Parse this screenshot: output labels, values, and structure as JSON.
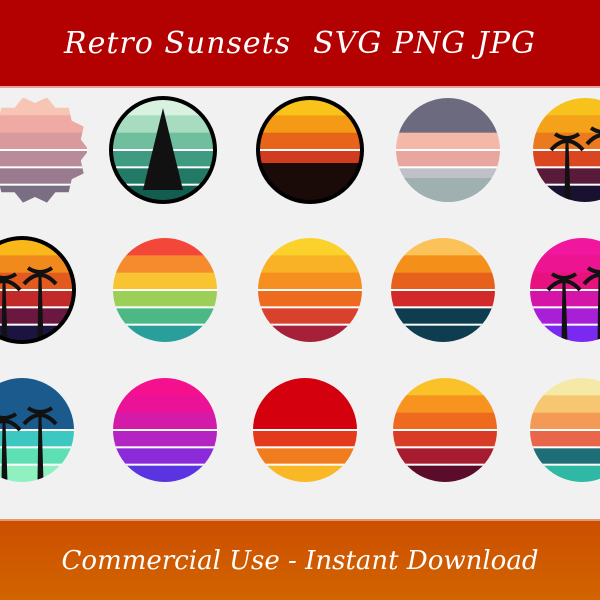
{
  "header": {
    "title": "Retro Sunsets",
    "formats": "SVG PNG JPG",
    "background": "#b30000"
  },
  "footer": {
    "text": "Commercial Use  -  Instant Download",
    "background": "#cc5200"
  },
  "sunsets": [
    {
      "colors": [
        "#f7c5b4",
        "#eeaaa3",
        "#d99a9e",
        "#b98a98",
        "#9a7a8e",
        "#7a6e82"
      ],
      "shape": "scalloped"
    },
    {
      "colors": [
        "#d9f2e0",
        "#a8dcc0",
        "#6fbf9e",
        "#3e9a80",
        "#227a66",
        "#135c50"
      ],
      "border": "#000",
      "silhouette": "pine-tree"
    },
    {
      "colors": [
        "#f9c31c",
        "#f59a15",
        "#e8641b",
        "#d13b1f",
        "#a61a1a",
        "#6e0e10"
      ],
      "border": "#000",
      "silhouette": "forest"
    },
    {
      "colors": [
        "#6c6a7e",
        "#6c6a7e",
        "#f3b8a8",
        "#e9a6a0",
        "#c0c0c8",
        "#9c9aa6"
      ],
      "silhouette": "treeline"
    },
    {
      "colors": [
        "#f7c21b",
        "#f4a21a",
        "#ea7a1d",
        "#d9461f",
        "#5a1a3a",
        "#1a1030"
      ],
      "silhouette": "palm-trees"
    },
    {
      "colors": [
        "#f9b71a",
        "#f08a1c",
        "#e35a1f",
        "#c22a2a",
        "#6a1840",
        "#1c1440"
      ],
      "border": "#000",
      "silhouette": "palm-trees"
    },
    {
      "colors": [
        "#f3473a",
        "#f68b2e",
        "#f8c431",
        "#9ccf58",
        "#4bb885",
        "#2a9e9a"
      ]
    },
    {
      "colors": [
        "#fbd22c",
        "#f9b125",
        "#f58f1f",
        "#ee6a1f",
        "#d8412b",
        "#a6203a"
      ]
    },
    {
      "colors": [
        "#fbc25a",
        "#f49019",
        "#e6611c",
        "#d22a2a",
        "#0d3d4f",
        "#0d3d4f"
      ]
    },
    {
      "colors": [
        "#f0179e",
        "#ec1490",
        "#e8127f",
        "#d514a8",
        "#a720d8",
        "#7a2af0"
      ],
      "silhouette": "palm-leaf"
    },
    {
      "colors": [
        "#1a5a8c",
        "#1a5a8c",
        "#1a5a8c",
        "#3cc8c0",
        "#5fe0b4",
        "#8ff0c0"
      ],
      "silhouette": "palm-trees"
    },
    {
      "colors": [
        "#f5118e",
        "#ea1296",
        "#d41aa8",
        "#b324c2",
        "#8a2ad8",
        "#5a34e0"
      ]
    },
    {
      "colors": [
        "#d4000e",
        "#d4000e",
        "#d4000e",
        "#e23a1a",
        "#f17c1e",
        "#fab826"
      ]
    },
    {
      "colors": [
        "#fbc128",
        "#f7941f",
        "#ee6a1f",
        "#d93c25",
        "#a61b30",
        "#5a0c2a"
      ]
    },
    {
      "colors": [
        "#f5e9a8",
        "#f7c670",
        "#f29a56",
        "#e8674a",
        "#1e6e78",
        "#2fb9a5"
      ]
    }
  ]
}
